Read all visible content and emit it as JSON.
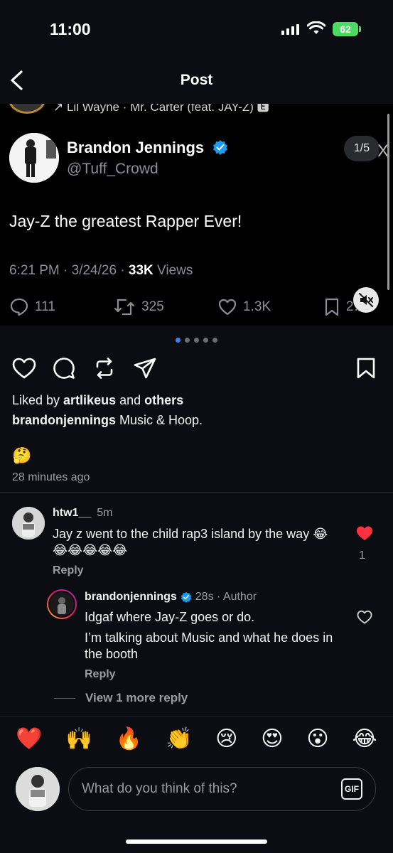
{
  "status_bar": {
    "time": "11:00",
    "battery": "62"
  },
  "nav": {
    "title": "Post"
  },
  "embed": {
    "top_attribution": "↗ Lil Wayne · Mr. Carter (feat. JAY-Z) 🅴",
    "pager": "1/5",
    "x_logo": "X",
    "tweet": {
      "name": "Brandon Jennings",
      "handle": "@Tuff_Crowd",
      "text": "Jay-Z the greatest Rapper Ever!",
      "time": "6:21 PM · 3/24/26 · ",
      "views_count": "33K",
      "views_label": " Views",
      "replies": "111",
      "retweets": "325",
      "likes": "1.3K",
      "bookmarks": "2…"
    }
  },
  "carousel": {
    "count": 5,
    "active": 0
  },
  "post": {
    "liked_by_prefix": "Liked by ",
    "liked_by_user": "artlikeus",
    "liked_by_mid": " and ",
    "liked_by_others": "others",
    "caption_user": "brandonjennings",
    "caption_text": " Music & Hoop.",
    "emoji": "🤔",
    "time_ago": "28 minutes ago"
  },
  "comments": [
    {
      "user": "htw1__",
      "time": "5m",
      "text": "Jay z went to the child rap3 island by the way 😂😂😂😂😂😂",
      "reply_label": "Reply",
      "likes": "1",
      "liked": true
    },
    {
      "user": "brandonjennings",
      "time": "28s · Author",
      "text_line1": "Idgaf where Jay-Z goes or do.",
      "text_line2": "I’m talking about Music and what he does in the booth",
      "reply_label": "Reply",
      "liked": false
    }
  ],
  "view_more_replies": "View 1 more reply",
  "quick_emojis": [
    "❤️",
    "🙌",
    "🔥",
    "👏",
    "😢",
    "😍",
    "😮",
    "😂"
  ],
  "comment_box": {
    "placeholder": "What do you think of this?",
    "gif_label": "GIF"
  },
  "colors": {
    "background": "#0b0d12",
    "like_red": "#ff3040",
    "verified_blue": "#1d9bf0",
    "battery_green": "#4cd964"
  }
}
